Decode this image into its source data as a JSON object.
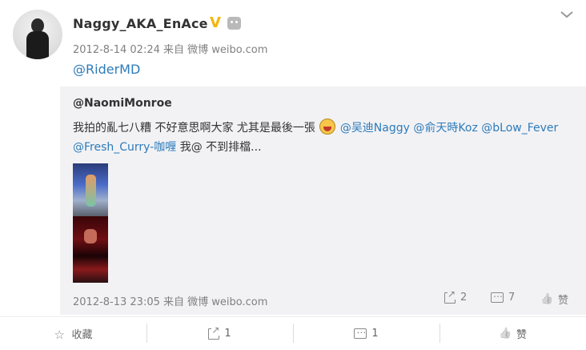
{
  "post": {
    "username": "Naggy_AKA_EnAce",
    "verified_badge": "V",
    "meta": "2012-8-14 02:24 来自 微博 weibo.com",
    "text": "@RiderMD"
  },
  "repost": {
    "username": "@NaomiMonroe",
    "text_part1": "我拍的亂七八糟 不好意思啊大家 尤其是最後一張",
    "mention1": "@吴迪Naggy",
    "mention2": "@俞天時Koz",
    "mention3": "@bLow_Fever",
    "mention4": "@Fresh_Curry-咖喱",
    "text_part2": " 我@ 不到排檔...",
    "meta": "2012-8-13 23:05 来自 微博 weibo.com",
    "forward_count": "2",
    "comment_count": "7",
    "like_label": "赞"
  },
  "actions": {
    "favorite_label": "收藏",
    "forward_count": "1",
    "comment_count": "1",
    "like_label": "赞"
  },
  "icons": [
    "chevron-down-icon",
    "verified-icon",
    "robot-icon",
    "share-icon",
    "comment-icon",
    "thumbs-up-icon",
    "star-icon"
  ]
}
